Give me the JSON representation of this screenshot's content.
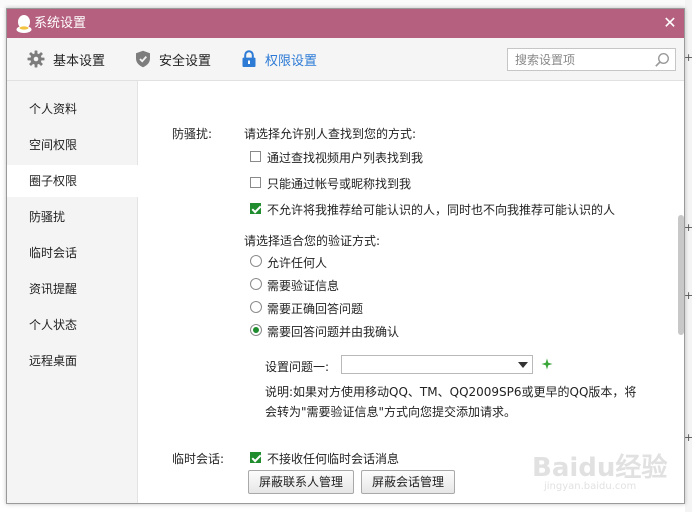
{
  "window": {
    "title": "系统设置",
    "close_glyph": "✕"
  },
  "toolbar": {
    "tabs": [
      {
        "label": "基本设置",
        "icon": "gear-icon"
      },
      {
        "label": "安全设置",
        "icon": "shield-icon"
      },
      {
        "label": "权限设置",
        "icon": "lock-icon",
        "active": true
      }
    ],
    "search_placeholder": "搜索设置项"
  },
  "sidebar": {
    "items": [
      {
        "label": "个人资料"
      },
      {
        "label": "空间权限"
      },
      {
        "label": "圈子权限",
        "active": true
      },
      {
        "label": "防骚扰"
      },
      {
        "label": "临时会话"
      },
      {
        "label": "资讯提醒"
      },
      {
        "label": "个人状态"
      },
      {
        "label": "远程桌面"
      }
    ]
  },
  "anti_harass": {
    "section_label": "防骚扰:",
    "find_prompt": "请选择允许别人查找到您的方式:",
    "find_options": [
      {
        "label": "通过查找视频用户列表找到我",
        "checked": false
      },
      {
        "label": "只能通过帐号或昵称找到我",
        "checked": false
      },
      {
        "label": "不允许将我推荐给可能认识的人，同时也不向我推荐可能认识的人",
        "checked": true
      }
    ],
    "verify_prompt": "请选择适合您的验证方式:",
    "verify_options": [
      {
        "label": "允许任何人",
        "selected": false
      },
      {
        "label": "需要验证信息",
        "selected": false
      },
      {
        "label": "需要正确回答问题",
        "selected": false
      },
      {
        "label": "需要回答问题并由我确认",
        "selected": true
      }
    ],
    "question_label": "设置问题一:",
    "question_value": "",
    "note_line1": "说明:如果对方使用移动QQ、TM、QQ2009SP6或更早的QQ版本，将",
    "note_line2": "会转为\"需要验证信息\"方式向您提交添加请求。"
  },
  "temp_session": {
    "section_label": "临时会话:",
    "option": {
      "label": "不接收任何临时会话消息",
      "checked": true
    },
    "buttons": {
      "block_contacts": "屏蔽联系人管理",
      "block_sessions": "屏蔽会话管理"
    }
  },
  "watermark": {
    "logo": "Baidu经验",
    "url": "jingyan.baidu.com"
  },
  "colors": {
    "titlebar": "#b5607f",
    "accent": "#2e7bd6",
    "check_green": "#1f8c2e"
  }
}
